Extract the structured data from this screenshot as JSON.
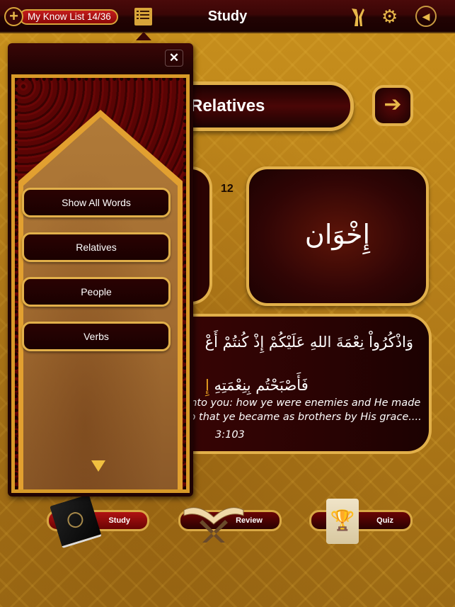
{
  "topbar": {
    "know_list_label": "My Know List 14/36",
    "add_icon": "plus-circle-icon",
    "list_icon": "list-icon",
    "title": "Study",
    "hands_icon": "praying-hands-icon",
    "settings_icon": "gear-icon",
    "sound_icon": "speaker-icon"
  },
  "category_popover": {
    "close_label": "✕",
    "items": [
      {
        "label": "Show All Words"
      },
      {
        "label": "Relatives"
      },
      {
        "label": "People"
      },
      {
        "label": "Verbs"
      }
    ],
    "scroll_indicator": "scroll-down-icon"
  },
  "main": {
    "category_title": "Relatives",
    "next_label": "➔",
    "card_number": "12",
    "word_arabic": "إِخْوَان",
    "verse": {
      "arabic_line1": "وَاذْكُرُواْ نِعْمَةَ اللهِ عَلَيْكُمْ إِذْ كُنتُمْ أَعْ",
      "arabic_line2": "فَأَصْبَحْتُم بِنِعْمَتِهِ",
      "arabic_highlight": "إِ",
      "english_line1": "unto you: how ye were enemies and He made",
      "english_line2": "so that ye became as brothers by His grace....",
      "reference": "3:103"
    }
  },
  "bottom_nav": {
    "items": [
      {
        "label": "Study",
        "icon": "quran-book-icon"
      },
      {
        "label": "Review",
        "icon": "book-stand-icon"
      },
      {
        "label": "Quiz",
        "icon": "trophy-scroll-icon"
      }
    ]
  }
}
